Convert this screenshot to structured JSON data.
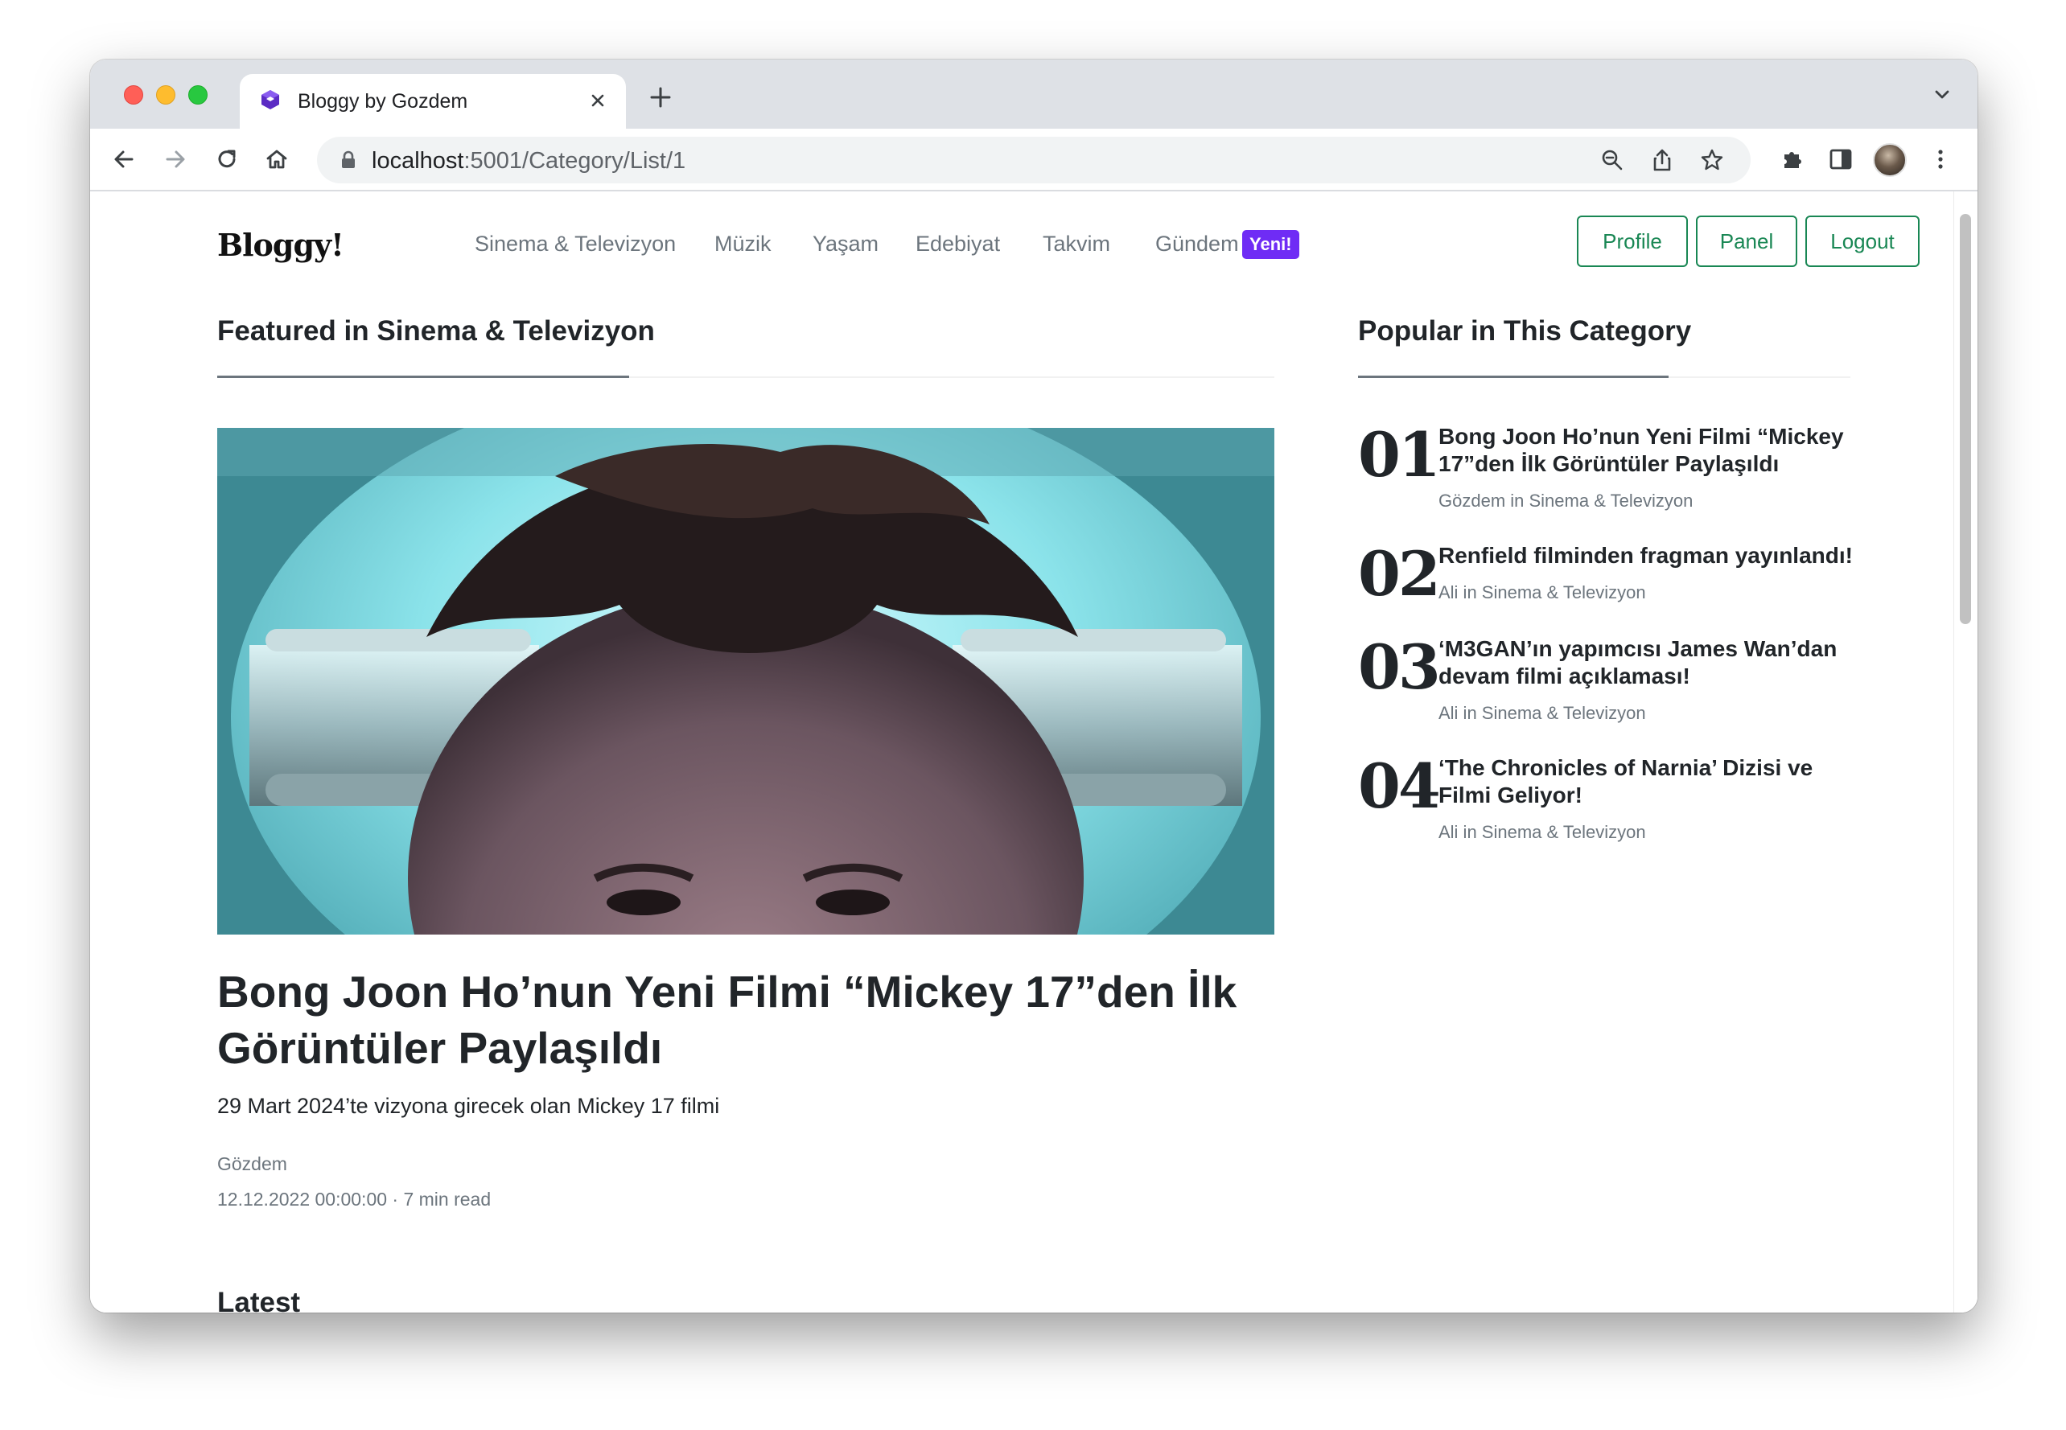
{
  "browser": {
    "tab_title": "Bloggy by Gozdem",
    "url_host": "localhost",
    "url_rest": ":5001/Category/List/1"
  },
  "site": {
    "brand": "Bloggy!",
    "nav": [
      {
        "label": "Sinema & Televizyon"
      },
      {
        "label": "Müzik"
      },
      {
        "label": "Yaşam"
      },
      {
        "label": "Edebiyat"
      },
      {
        "label": "Takvim"
      },
      {
        "label": "Gündem",
        "badge": "Yeni!"
      }
    ],
    "buttons": {
      "profile": "Profile",
      "panel": "Panel",
      "logout": "Logout"
    },
    "accent_color": "#198754",
    "badge_color": "#6f2cf5"
  },
  "featured": {
    "section_title": "Featured in Sinema & Televizyon",
    "title": "Bong Joon Ho’nun Yeni Filmi “Mickey 17”den İlk Görüntüler Paylaşıldı",
    "subtitle": "29 Mart 2024’te vizyona girecek olan Mickey 17 filmi",
    "author": "Gözdem",
    "date_read": "12.12.2022 00:00:00 · 7 min read"
  },
  "popular": {
    "section_title": "Popular in This Category",
    "items": [
      {
        "num": "01",
        "title": "Bong Joon Ho’nun Yeni Filmi “Mickey 17”den İlk Görüntüler Paylaşıldı",
        "meta": "Gözdem in Sinema & Televizyon"
      },
      {
        "num": "02",
        "title": "Renfield filminden fragman yayınlandı!",
        "meta": "Ali in Sinema & Televizyon"
      },
      {
        "num": "03",
        "title": "‘M3GAN’ın yapımcısı James Wan’dan devam filmi açıklaması!",
        "meta": "Ali in Sinema & Televizyon"
      },
      {
        "num": "04",
        "title": "‘The Chronicles of Narnia’ Dizisi ve Filmi Geliyor!",
        "meta": "Ali in Sinema & Televizyon"
      }
    ]
  },
  "latest": {
    "section_title": "Latest"
  }
}
